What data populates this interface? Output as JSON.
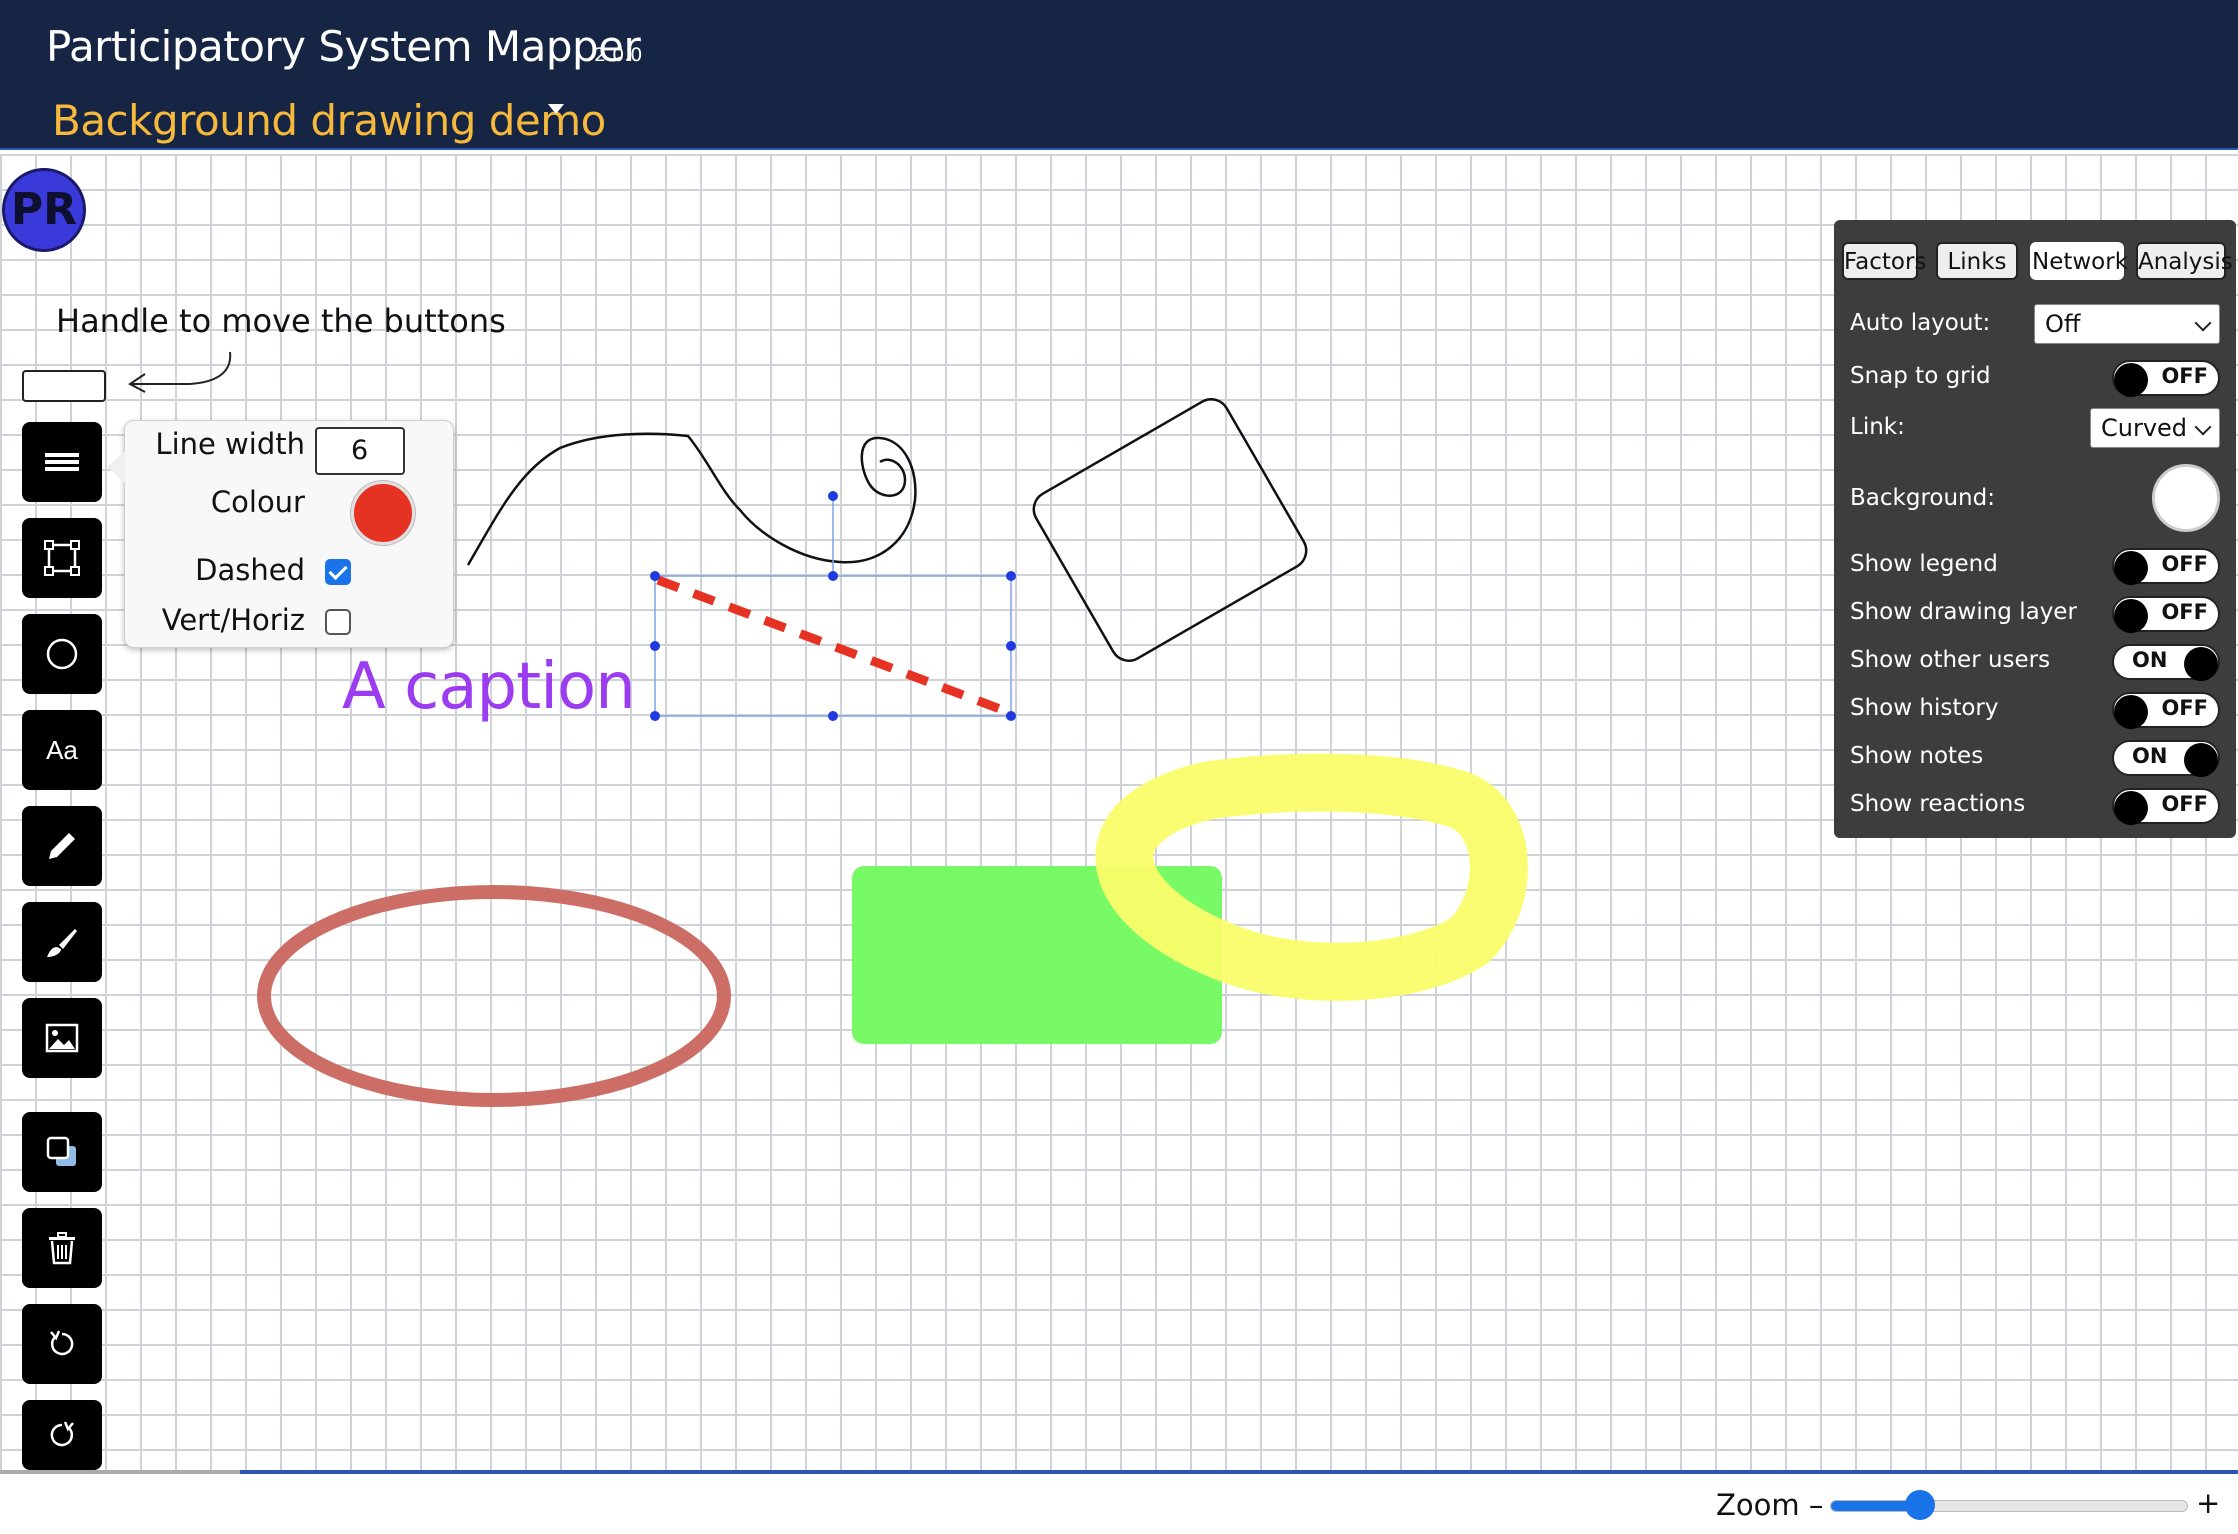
{
  "header": {
    "app_title": "Participatory System Mapper",
    "version": "2.0.0",
    "map_title": "Background drawing demo"
  },
  "avatar": {
    "initials": "PR",
    "color": "#3a39d9"
  },
  "annotation": {
    "text": "Handle to move the buttons"
  },
  "toolbar": {
    "text_tool_label": "Aa",
    "tools": [
      "line-width-icon",
      "rectangle-icon",
      "circle-icon",
      "text-icon",
      "pencil-icon",
      "brush-icon",
      "image-icon",
      "duplicate-icon",
      "trash-icon",
      "undo-icon",
      "redo-icon"
    ]
  },
  "line_popup": {
    "line_width_label": "Line width",
    "line_width_value": "6",
    "colour_label": "Colour",
    "colour_value": "#e63223",
    "dashed_label": "Dashed",
    "dashed_checked": true,
    "vert_horiz_label": "Vert/Horiz",
    "vert_horiz_checked": false
  },
  "canvas": {
    "caption_text": "A caption",
    "caption_color": "#9b3cf0"
  },
  "panel": {
    "tabs": [
      "Factors",
      "Links",
      "Network",
      "Analysis"
    ],
    "auto_layout_label": "Auto layout:",
    "auto_layout_value": "Off",
    "snap_label": "Snap to grid",
    "snap_state": "OFF",
    "link_label": "Link:",
    "link_value": "Curved",
    "background_label": "Background:",
    "background_color": "#ffffff",
    "show_legend_label": "Show legend",
    "show_legend_state": "OFF",
    "show_drawing_label": "Show drawing layer",
    "show_drawing_state": "OFF",
    "show_users_label": "Show other users",
    "show_users_state": "ON",
    "show_history_label": "Show history",
    "show_history_state": "OFF",
    "show_notes_label": "Show notes",
    "show_notes_state": "ON",
    "show_reactions_label": "Show reactions",
    "show_reactions_state": "OFF"
  },
  "footer": {
    "zoom_label": "Zoom –",
    "zoom_plus": "+",
    "zoom_level": 0.25
  }
}
